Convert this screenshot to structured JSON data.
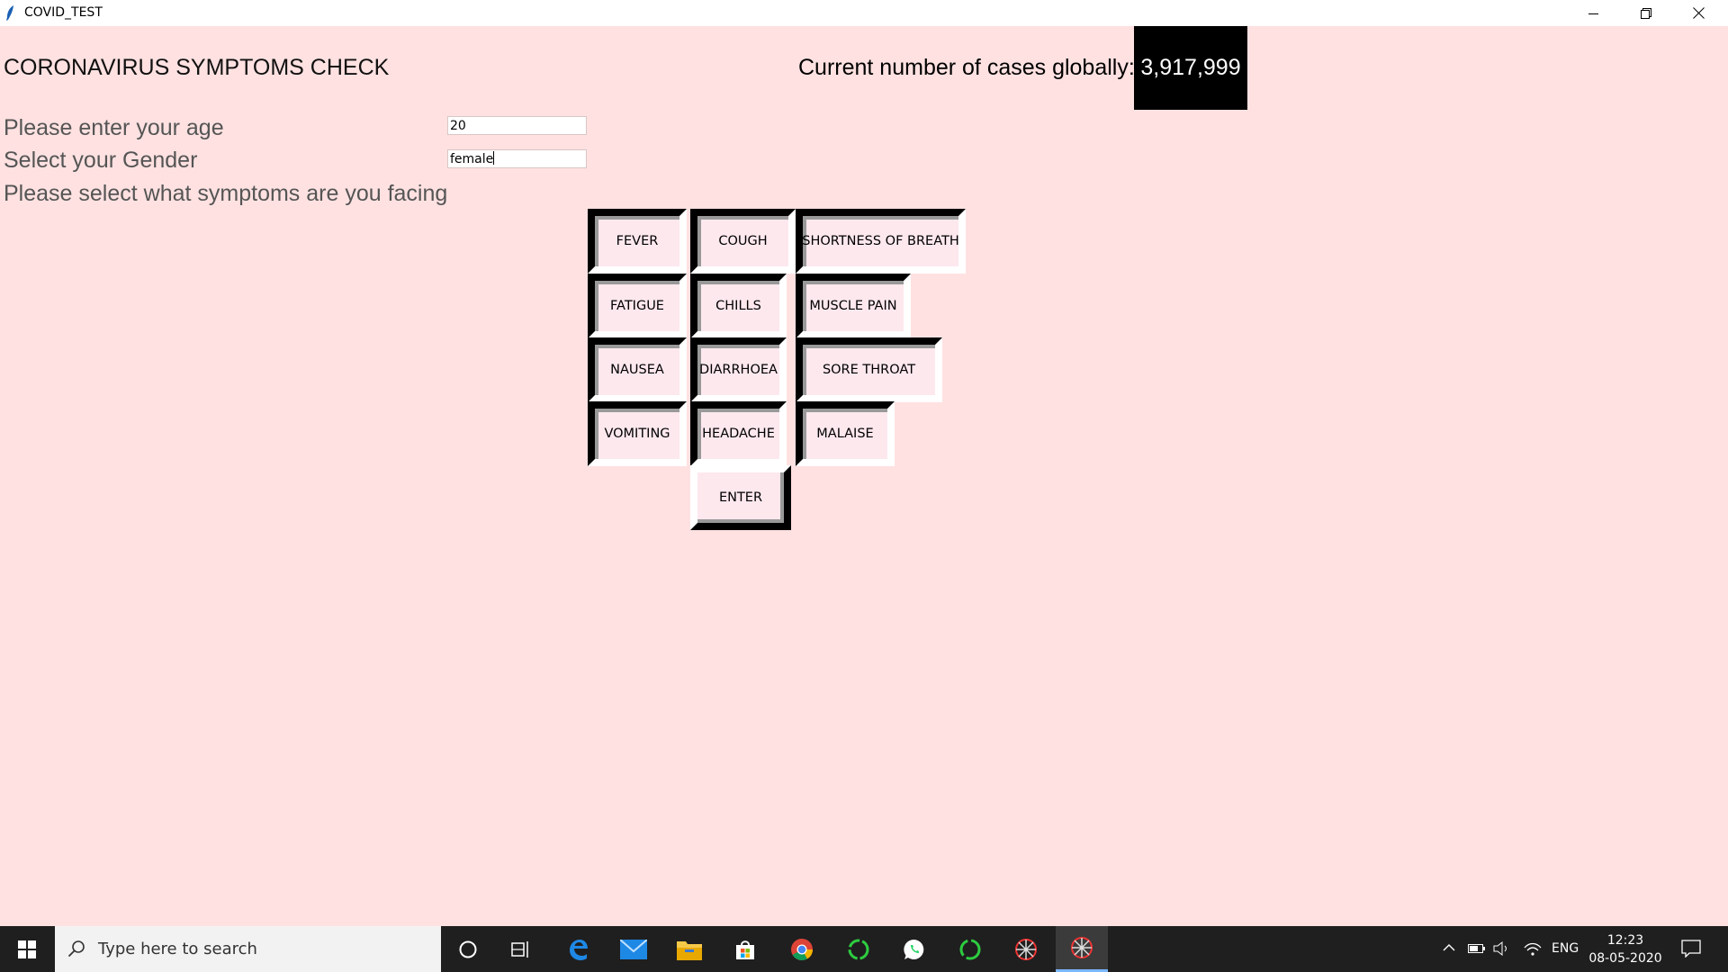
{
  "window": {
    "title": "COVID_TEST"
  },
  "app": {
    "heading": "CORONAVIRUS SYMPTOMS CHECK",
    "cases_label": "Current number of cases globally:",
    "cases_value": "3,917,999",
    "age_label": "Please enter your age",
    "age_value": "20",
    "gender_label": "Select your Gender",
    "gender_value": "female",
    "symptoms_label": "Please select what symptoms are you facing",
    "symptoms": {
      "fever": "FEVER",
      "cough": "COUGH",
      "shortness_of_breath": "SHORTNESS OF BREATH",
      "fatigue": "FATIGUE",
      "chills": "CHILLS",
      "muscle_pain": "MUSCLE PAIN",
      "nausea": "NAUSEA",
      "diarrhoea": "DIARRHOEA",
      "sore_throat": "SORE THROAT",
      "vomiting": "VOMITING",
      "headache": "HEADACHE",
      "malaise": "MALAISE"
    },
    "enter_label": "ENTER"
  },
  "taskbar": {
    "search_placeholder": "Type here to search",
    "language": "ENG",
    "time": "12:23",
    "date": "08-05-2020",
    "pinned": [
      "cortana-icon",
      "task-view-icon",
      "edge-icon",
      "mail-icon",
      "file-explorer-icon",
      "store-icon",
      "chrome-icon",
      "green-ring-app-icon",
      "whatsapp-icon",
      "green-ring-app-icon",
      "feather-app-icon",
      "feather-app-icon"
    ]
  }
}
